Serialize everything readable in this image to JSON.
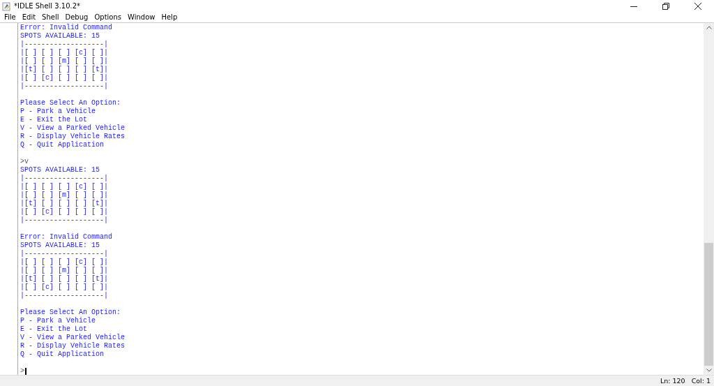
{
  "window": {
    "title": "*IDLE Shell 3.10.2*"
  },
  "menu": [
    "File",
    "Edit",
    "Shell",
    "Debug",
    "Options",
    "Window",
    "Help"
  ],
  "shell": {
    "blocks": [
      {
        "lines": [
          "Error: Invalid Command",
          "SPOTS AVAILABLE: 15",
          "|-------------------|",
          "|[ ] [ ] [ ] [c] [ ]|",
          "|[ ] [ ] [m] [ ] [ ]|",
          "|[t] [ ] [ ] [ ] [t]|",
          "|[ ] [c] [ ] [ ] [ ]|",
          "|-------------------|"
        ]
      },
      {
        "lines": [
          "Please Select An Option:",
          "P - Park a Vehicle",
          "E - Exit the Lot",
          "V - View a Parked Vehicle",
          "R - Display Vehicle Rates",
          "Q - Quit Application"
        ]
      },
      {
        "input": ">v",
        "lines": [
          "SPOTS AVAILABLE: 15",
          "|-------------------|",
          "|[ ] [ ] [ ] [c] [ ]|",
          "|[ ] [ ] [m] [ ] [ ]|",
          "|[t] [ ] [ ] [ ] [t]|",
          "|[ ] [c] [ ] [ ] [ ]|",
          "|-------------------|"
        ]
      },
      {
        "lines": [
          "Error: Invalid Command",
          "SPOTS AVAILABLE: 15",
          "|-------------------|",
          "|[ ] [ ] [ ] [c] [ ]|",
          "|[ ] [ ] [m] [ ] [ ]|",
          "|[t] [ ] [ ] [ ] [t]|",
          "|[ ] [c] [ ] [ ] [ ]|",
          "|-------------------|"
        ]
      },
      {
        "lines": [
          "Please Select An Option:",
          "P - Park a Vehicle",
          "E - Exit the Lot",
          "V - View a Parked Vehicle",
          "R - Display Vehicle Rates",
          "Q - Quit Application"
        ]
      },
      {
        "input": ">",
        "cursor": true
      }
    ]
  },
  "status_bar": {
    "line": "Ln: 120",
    "column": "Col: 1"
  }
}
